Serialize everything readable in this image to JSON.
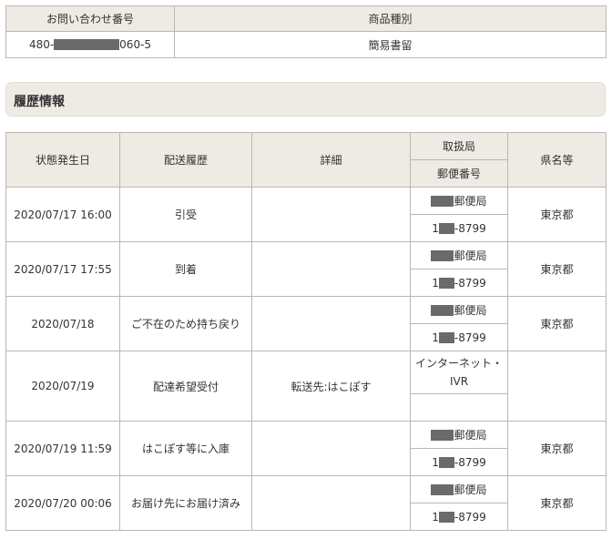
{
  "summary": {
    "headers": {
      "tracking": "お問い合わせ番号",
      "type": "商品種別"
    },
    "tracking_prefix": "480-",
    "tracking_suffix": "060-5",
    "item_type": "簡易書留"
  },
  "history": {
    "section_title": "履歴情報",
    "headers": {
      "date": "状態発生日",
      "status": "配送履歴",
      "detail": "詳細",
      "office": "取扱局",
      "zip": "郵便番号",
      "pref": "県名等"
    },
    "rows": [
      {
        "date": "2020/07/17 16:00",
        "status": "引受",
        "detail": "",
        "office": "郵便局",
        "zip_prefix": "1",
        "zip_suffix": "-8799",
        "pref": "東京都"
      },
      {
        "date": "2020/07/17 17:55",
        "status": "到着",
        "detail": "",
        "office": "郵便局",
        "zip_prefix": "1",
        "zip_suffix": "-8799",
        "pref": "東京都"
      },
      {
        "date": "2020/07/18",
        "status": "ご不在のため持ち戻り",
        "detail": "",
        "office": "郵便局",
        "zip_prefix": "1",
        "zip_suffix": "-8799",
        "pref": "東京都"
      },
      {
        "date": "2020/07/19",
        "status": "配達希望受付",
        "detail": "転送先:はこぽす",
        "office": "インターネット・IVR",
        "zip": "",
        "pref": ""
      },
      {
        "date": "2020/07/19 11:59",
        "status": "はこぽす等に入庫",
        "detail": "",
        "office": "郵便局",
        "zip_prefix": "1",
        "zip_suffix": "-8799",
        "pref": "東京都"
      },
      {
        "date": "2020/07/20 00:06",
        "status": "お届け先にお届け済み",
        "detail": "",
        "office": "郵便局",
        "zip_prefix": "1",
        "zip_suffix": "-8799",
        "pref": "東京都"
      }
    ]
  }
}
